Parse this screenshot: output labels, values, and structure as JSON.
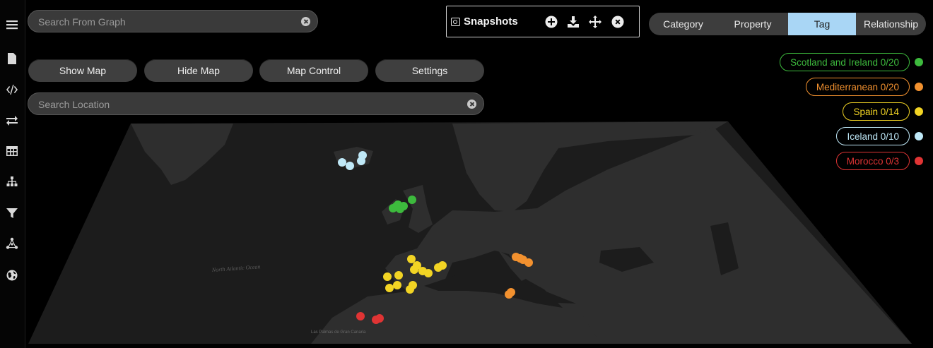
{
  "rail": {
    "items": [
      {
        "name": "menu-icon"
      },
      {
        "name": "document-icon"
      },
      {
        "name": "code-icon"
      },
      {
        "name": "swap-icon"
      },
      {
        "name": "table-icon"
      },
      {
        "name": "hierarchy-icon"
      },
      {
        "name": "filter-icon"
      },
      {
        "name": "network-icon"
      },
      {
        "name": "globe-icon"
      }
    ]
  },
  "graph_search": {
    "placeholder": "Search From Graph",
    "value": ""
  },
  "location_search": {
    "placeholder": "Search Location",
    "value": ""
  },
  "buttons": {
    "show_map": "Show Map",
    "hide_map": "Hide Map",
    "map_control": "Map Control",
    "settings": "Settings"
  },
  "snapshots": {
    "title": "Snapshots",
    "actions": [
      "add-icon",
      "download-icon",
      "move-icon",
      "close-icon"
    ]
  },
  "tabs": {
    "items": [
      "Category",
      "Property",
      "Tag",
      "Relationship"
    ],
    "active": "Tag"
  },
  "legend": [
    {
      "label": "Scotland and Ireland 0/20",
      "color": "#3dba3d"
    },
    {
      "label": "Mediterranean 0/20",
      "color": "#f2912f"
    },
    {
      "label": "Spain 0/14",
      "color": "#f2d424"
    },
    {
      "label": "Iceland 0/10",
      "color": "#bfe8f7"
    },
    {
      "label": "Morocco 0/3",
      "color": "#e03434"
    }
  ],
  "map_labels": {
    "ocean": "North Atlantic Ocean",
    "islands": "Las Palmas de Gran Canaria"
  },
  "colors": {
    "accent_tab": "#a9d6f5",
    "map_land": "#2b2b2b",
    "map_water": "#1b1b1b"
  }
}
